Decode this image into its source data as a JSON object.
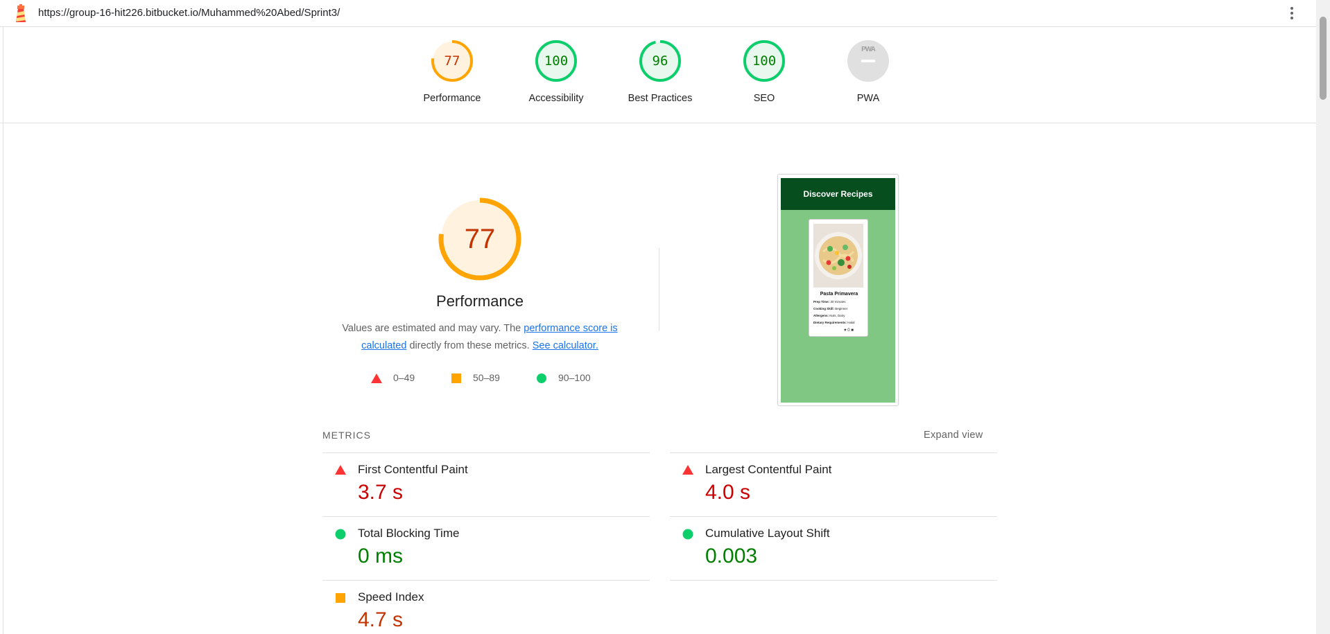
{
  "browser": {
    "url": "https://group-16-hit226.bitbucket.io/Muhammed%20Abed/Sprint3/"
  },
  "colors": {
    "fail": "#ff3333",
    "average": "#ffa400",
    "pass": "#0cce6b",
    "na": "#e0e0e0"
  },
  "gauges": [
    {
      "label": "Performance",
      "score": "77",
      "status": "average",
      "value": 0.77
    },
    {
      "label": "Accessibility",
      "score": "100",
      "status": "pass",
      "value": 1.0
    },
    {
      "label": "Best Practices",
      "score": "96",
      "status": "pass",
      "value": 0.96
    },
    {
      "label": "SEO",
      "score": "100",
      "status": "pass",
      "value": 1.0
    },
    {
      "label": "PWA",
      "score": "PWA",
      "status": "na"
    }
  ],
  "performance": {
    "score": "77",
    "value": 0.77,
    "title": "Performance",
    "desc_prefix": "Values are estimated and may vary. The ",
    "desc_link1": "performance score is calculated",
    "desc_middle": " directly from these metrics. ",
    "desc_link2": "See calculator.",
    "legend": [
      {
        "range": "0–49",
        "icon": "triangle-icon"
      },
      {
        "range": "50–89",
        "icon": "square-icon"
      },
      {
        "range": "90–100",
        "icon": "circle-icon"
      }
    ]
  },
  "screenshot": {
    "header": "Discover Recipes",
    "card_title": "Pasta Primavera",
    "lines": [
      {
        "key": "Prep Time:",
        "val": " 30 minutes"
      },
      {
        "key": "Cooking Skill:",
        "val": " Beginner"
      },
      {
        "key": "Allergens:",
        "val": " Nuts, Dairy"
      },
      {
        "key": "Dietary Requirements:",
        "val": " Halal"
      }
    ],
    "likes": "0"
  },
  "metrics": {
    "heading": "METRICS",
    "expand_label": "Expand view",
    "items": [
      {
        "name": "First Contentful Paint",
        "value": "3.7 s",
        "status": "fail"
      },
      {
        "name": "Largest Contentful Paint",
        "value": "4.0 s",
        "status": "fail"
      },
      {
        "name": "Total Blocking Time",
        "value": "0 ms",
        "status": "pass"
      },
      {
        "name": "Cumulative Layout Shift",
        "value": "0.003",
        "status": "pass"
      },
      {
        "name": "Speed Index",
        "value": "4.7 s",
        "status": "average"
      }
    ]
  }
}
